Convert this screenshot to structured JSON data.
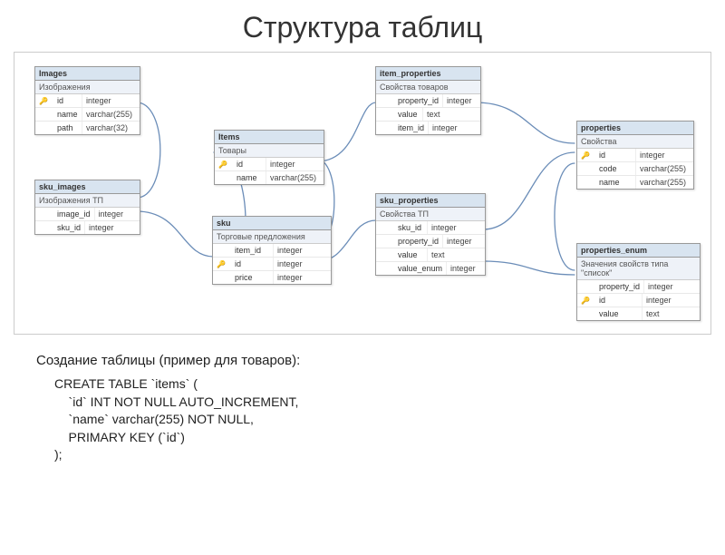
{
  "title": "Структура таблиц",
  "caption": "Создание таблицы (пример для товаров):",
  "sql": "CREATE TABLE `items` (\n    `id` INT NOT NULL AUTO_INCREMENT,\n    `name` varchar(255) NOT NULL,\n    PRIMARY KEY (`id`)\n);",
  "tables": {
    "images": {
      "name": "Images",
      "subtitle": "Изображения",
      "cols": [
        {
          "k": true,
          "n": "id",
          "t": "integer"
        },
        {
          "k": false,
          "n": "name",
          "t": "varchar(255)"
        },
        {
          "k": false,
          "n": "path",
          "t": "varchar(32)"
        }
      ]
    },
    "sku_images": {
      "name": "sku_images",
      "subtitle": "Изображения ТП",
      "cols": [
        {
          "k": false,
          "n": "image_id",
          "t": "integer"
        },
        {
          "k": false,
          "n": "sku_id",
          "t": "integer"
        }
      ]
    },
    "items": {
      "name": "Items",
      "subtitle": "Товары",
      "cols": [
        {
          "k": true,
          "n": "id",
          "t": "integer"
        },
        {
          "k": false,
          "n": "name",
          "t": "varchar(255)"
        }
      ]
    },
    "sku": {
      "name": "sku",
      "subtitle": "Торговые предложения",
      "cols": [
        {
          "k": false,
          "n": "item_id",
          "t": "integer"
        },
        {
          "k": true,
          "n": "id",
          "t": "integer"
        },
        {
          "k": false,
          "n": "price",
          "t": "integer"
        }
      ]
    },
    "item_properties": {
      "name": "item_properties",
      "subtitle": "Свойства товаров",
      "cols": [
        {
          "k": false,
          "n": "property_id",
          "t": "integer"
        },
        {
          "k": false,
          "n": "value",
          "t": "text"
        },
        {
          "k": false,
          "n": "item_id",
          "t": "integer"
        }
      ]
    },
    "sku_properties": {
      "name": "sku_properties",
      "subtitle": "Свойства ТП",
      "cols": [
        {
          "k": false,
          "n": "sku_id",
          "t": "integer"
        },
        {
          "k": false,
          "n": "property_id",
          "t": "integer"
        },
        {
          "k": false,
          "n": "value",
          "t": "text"
        },
        {
          "k": false,
          "n": "value_enum",
          "t": "integer"
        }
      ]
    },
    "properties": {
      "name": "properties",
      "subtitle": "Свойства",
      "cols": [
        {
          "k": true,
          "n": "id",
          "t": "integer"
        },
        {
          "k": false,
          "n": "code",
          "t": "varchar(255)"
        },
        {
          "k": false,
          "n": "name",
          "t": "varchar(255)"
        }
      ]
    },
    "properties_enum": {
      "name": "properties_enum",
      "subtitle": "Значения свойств типа \"список\"",
      "cols": [
        {
          "k": false,
          "n": "property_id",
          "t": "integer"
        },
        {
          "k": true,
          "n": "id",
          "t": "integer"
        },
        {
          "k": false,
          "n": "value",
          "t": "text"
        }
      ]
    }
  }
}
